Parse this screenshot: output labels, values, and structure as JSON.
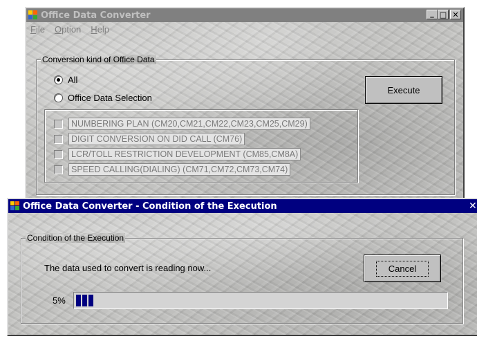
{
  "colors": {
    "title_active": "#000080",
    "title_inactive": "#808080",
    "progress_fill": "#000080",
    "face": "#c0c0c0"
  },
  "main_window": {
    "title": "Office Data Converter",
    "icon": "app-icon",
    "controls": {
      "minimize": "_",
      "maximize": "□",
      "close": "✕"
    },
    "menu": [
      "File",
      "Option",
      "Help"
    ],
    "group_label": "Conversion kind of Office Data",
    "radios": [
      {
        "label": "All",
        "selected": true
      },
      {
        "label": "Office Data Selection",
        "selected": false
      }
    ],
    "execute_label": "Execute",
    "checkboxes": [
      "NUMBERING PLAN (CM20,CM21,CM22,CM23,CM25,CM29)",
      "DIGIT CONVERSION ON DID CALL (CM76)",
      "LCR/TOLL RESTRICTION DEVELOPMENT (CM85,CM8A)",
      "SPEED CALLING(DIALING) (CM71,CM72,CM73,CM74)"
    ]
  },
  "dialog": {
    "title": "Office Data Converter - Condition of the Execution",
    "icon": "app-icon",
    "close": "✕",
    "group_label": "Condition of the Execution",
    "status_text": "The data used to convert is reading now...",
    "cancel_label": "Cancel",
    "progress_text": "5%",
    "progress_fraction": 0.05
  }
}
